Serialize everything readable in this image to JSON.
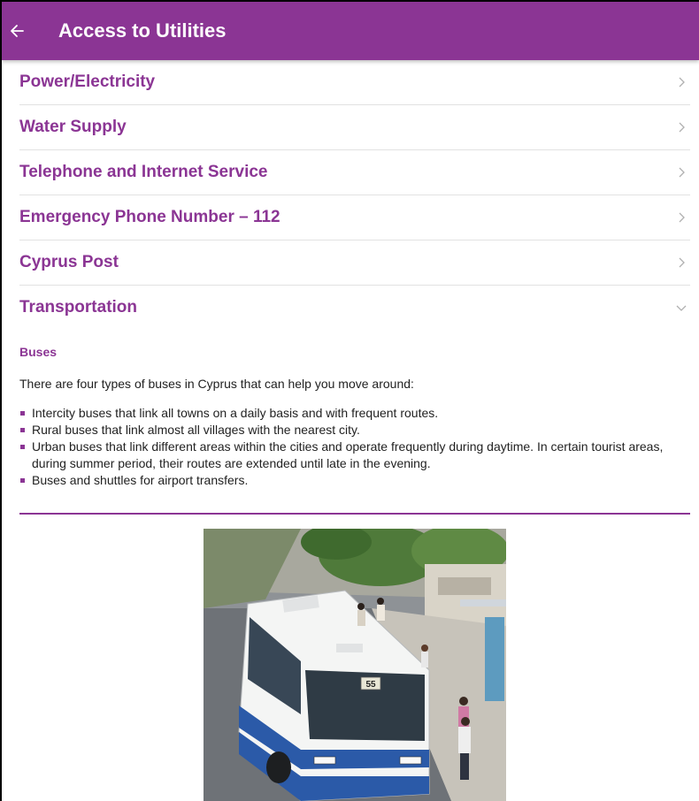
{
  "header": {
    "back_icon": "arrow-left-icon",
    "title": "Access to Utilities"
  },
  "colors": {
    "brand": "#8b3594",
    "divider": "#e2e2e2",
    "text": "#222222"
  },
  "menu": {
    "items": [
      {
        "label": "Power/Electricity",
        "icon": "chevron-right-icon"
      },
      {
        "label": "Water Supply",
        "icon": "chevron-right-icon"
      },
      {
        "label": "Telephone and Internet Service",
        "icon": "chevron-right-icon"
      },
      {
        "label": "Emergency Phone Number – 112",
        "icon": "chevron-right-icon"
      },
      {
        "label": "Cyprus Post",
        "icon": "chevron-right-icon"
      },
      {
        "label": "Transportation",
        "icon": "chevron-down-icon",
        "expanded": true
      }
    ]
  },
  "transportation": {
    "heading": "Buses",
    "intro": "There are four types of buses in Cyprus that can help you move around:",
    "bullets": [
      "Intercity buses that link all towns on a daily basis and with frequent routes.",
      "Rural buses that link almost all villages with the nearest city.",
      "Urban buses that link different areas within the cities and operate frequently during daytime. In certain tourist areas, during summer period, their routes are extended until late in the evening.",
      "Buses and shuttles for airport transfers."
    ],
    "photo": {
      "route_number": "55"
    }
  }
}
